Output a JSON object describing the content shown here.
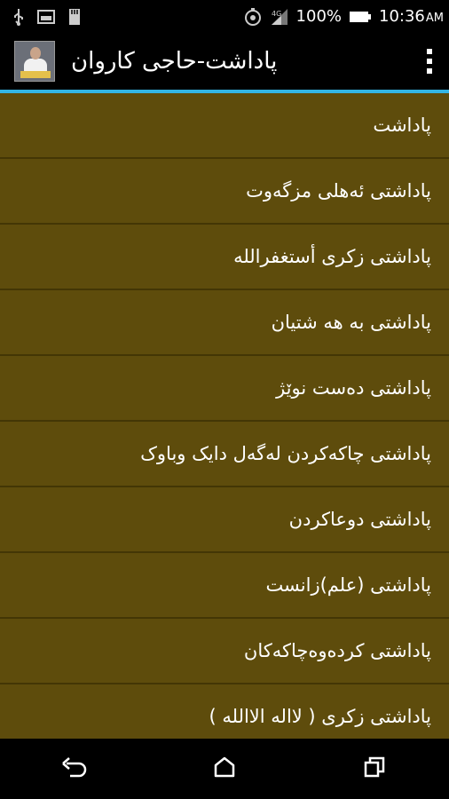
{
  "status_bar": {
    "battery_percent": "100%",
    "time": "10:36",
    "time_suffix": "AM",
    "icons": [
      "usb-icon",
      "image-icon",
      "sd-card-icon",
      "sync-icon",
      "signal-icon",
      "battery-icon"
    ]
  },
  "action_bar": {
    "title": "پاداشت-حاجی کاروان",
    "logo_text": "پاداشت",
    "accent_color": "#33b5e5"
  },
  "list": {
    "background_color": "#5e4c0c",
    "items": [
      {
        "label": "پاداشت"
      },
      {
        "label": "پاداشتی ئەهلی مزگەوت"
      },
      {
        "label": "پاداشتی زکری أستغفرالله"
      },
      {
        "label": "پاداشتی به هه شتیان"
      },
      {
        "label": "پاداشتی دەست نوێژ"
      },
      {
        "label": "پاداشتی چاکەکردن لەگەل دایک وباوک"
      },
      {
        "label": "پاداشتی دوعاکردن"
      },
      {
        "label": "پاداشتی (علم)زانست"
      },
      {
        "label": "پاداشتی کردەوەچاکەکان"
      },
      {
        "label": "پاداشتی زکری ( لااله الاالله )"
      }
    ]
  },
  "nav_bar": {
    "buttons": [
      "back-icon",
      "home-icon",
      "recent-apps-icon"
    ]
  }
}
